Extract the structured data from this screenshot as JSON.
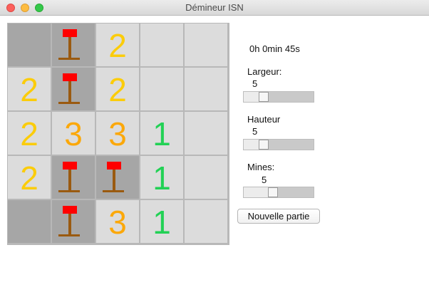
{
  "window": {
    "title": "Démineur ISN"
  },
  "timer": "0h 0min 45s",
  "settings": {
    "width": {
      "label": "Largeur:",
      "value": "5",
      "level": 0.25
    },
    "height": {
      "label": "Hauteur",
      "value": "5",
      "level": 0.25
    },
    "mines": {
      "label": "Mines:",
      "value": "5",
      "level": 0.4
    }
  },
  "new_game_label": "Nouvelle partie",
  "board": {
    "cols": 5,
    "rows": 5,
    "cells": [
      [
        {
          "state": "hidden"
        },
        {
          "state": "flag"
        },
        {
          "state": "revealed",
          "value": "2"
        },
        {
          "state": "revealed"
        },
        {
          "state": "revealed"
        }
      ],
      [
        {
          "state": "revealed",
          "value": "2"
        },
        {
          "state": "flag"
        },
        {
          "state": "revealed",
          "value": "2"
        },
        {
          "state": "revealed"
        },
        {
          "state": "revealed"
        }
      ],
      [
        {
          "state": "revealed",
          "value": "2"
        },
        {
          "state": "revealed",
          "value": "3"
        },
        {
          "state": "revealed",
          "value": "3"
        },
        {
          "state": "revealed",
          "value": "1"
        },
        {
          "state": "revealed"
        }
      ],
      [
        {
          "state": "revealed",
          "value": "2"
        },
        {
          "state": "flag"
        },
        {
          "state": "flag"
        },
        {
          "state": "revealed",
          "value": "1"
        },
        {
          "state": "revealed"
        }
      ],
      [
        {
          "state": "hidden"
        },
        {
          "state": "flag"
        },
        {
          "state": "revealed",
          "value": "3"
        },
        {
          "state": "revealed",
          "value": "1"
        },
        {
          "state": "revealed"
        }
      ]
    ]
  },
  "colors": {
    "one": "#22d155",
    "two": "#fbcc0a",
    "three": "#fba80a",
    "flag_red": "#ff0000",
    "flag_pole": "#9a5a10"
  }
}
